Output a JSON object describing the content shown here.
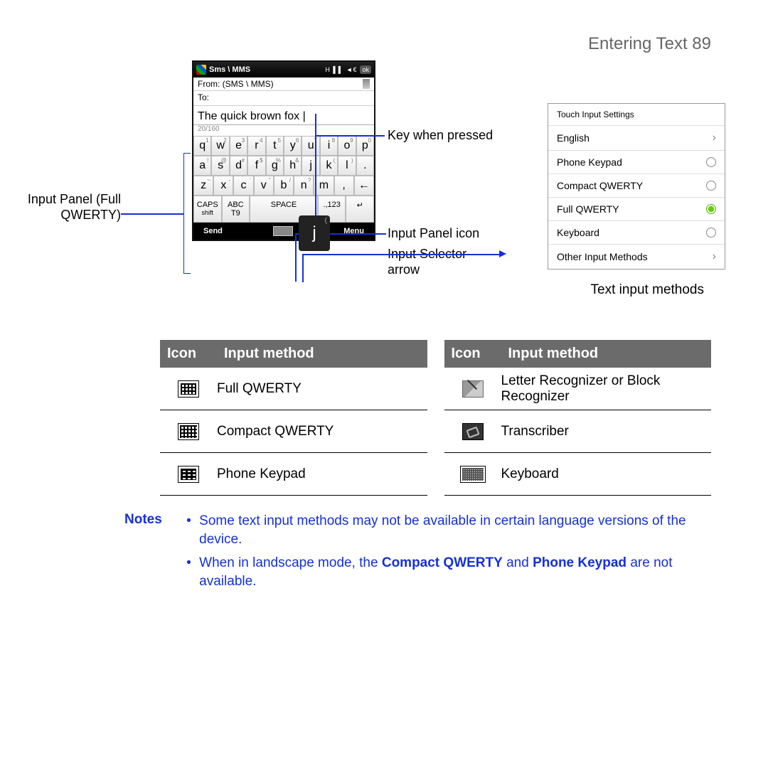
{
  "header": {
    "title": "Entering Text",
    "page": "89"
  },
  "phone": {
    "title": "Sms \\ MMS",
    "status": "H ▌▌ ◄€",
    "ok": "ok",
    "from": "From: (SMS \\ MMS)",
    "to": "To:",
    "message": "The quick brown fox",
    "counter": "20/160",
    "rows": [
      [
        {
          "k": "q",
          "s": "1"
        },
        {
          "k": "w",
          "s": "2"
        },
        {
          "k": "e",
          "s": "3"
        },
        {
          "k": "r",
          "s": "4"
        },
        {
          "k": "t",
          "s": "5"
        },
        {
          "k": "y",
          "s": "6"
        },
        {
          "k": "u",
          "s": "7"
        },
        {
          "k": "i",
          "s": "8"
        },
        {
          "k": "o",
          "s": "9"
        },
        {
          "k": "p",
          "s": "0"
        }
      ],
      [
        {
          "k": "a",
          "s": "!"
        },
        {
          "k": "s",
          "s": "@"
        },
        {
          "k": "d",
          "s": "#"
        },
        {
          "k": "f",
          "s": "$"
        },
        {
          "k": "g",
          "s": "%"
        },
        {
          "k": "h",
          "s": "&"
        },
        {
          "k": "j",
          "s": "*"
        },
        {
          "k": "k",
          "s": "("
        },
        {
          "k": "l",
          "s": ")"
        },
        {
          "k": ".",
          "s": ""
        }
      ],
      [
        {
          "k": "z",
          "s": "~"
        },
        {
          "k": "x",
          "s": "-"
        },
        {
          "k": "c",
          "s": "'"
        },
        {
          "k": "v",
          "s": "\""
        },
        {
          "k": "b",
          "s": "/"
        },
        {
          "k": "n",
          "s": "?"
        },
        {
          "k": "m",
          "s": ""
        },
        {
          "k": ",",
          "s": ""
        },
        {
          "k": "←",
          "s": ""
        }
      ],
      [
        {
          "k": "CAPS\nshift"
        },
        {
          "k": "ABC T9"
        },
        {
          "k": "SPACE"
        },
        {
          "k": ".,123"
        },
        {
          "k": "↵"
        }
      ]
    ],
    "softkeys": {
      "left": "Send",
      "right": "Menu"
    },
    "popup_key": "j"
  },
  "callouts": {
    "input_panel": "Input Panel (Full QWERTY)",
    "key_pressed": "Key when pressed",
    "panel_icon": "Input Panel icon",
    "selector_arrow": "Input Selector arrow",
    "menu_caption": "Text input methods"
  },
  "menu": {
    "title": "Touch Input Settings",
    "items": [
      {
        "label": "English",
        "type": "chev"
      },
      {
        "label": "Phone Keypad",
        "type": "radio",
        "on": false
      },
      {
        "label": "Compact QWERTY",
        "type": "radio",
        "on": false
      },
      {
        "label": "Full QWERTY",
        "type": "radio",
        "on": true
      },
      {
        "label": "Keyboard",
        "type": "radio",
        "on": false
      },
      {
        "label": "Other Input Methods",
        "type": "chev"
      }
    ]
  },
  "table_headers": {
    "icon": "Icon",
    "method": "Input method"
  },
  "left_table": [
    {
      "icon": "fullq",
      "label": "Full QWERTY"
    },
    {
      "icon": "compq",
      "label": "Compact QWERTY"
    },
    {
      "icon": "keypad",
      "label": "Phone Keypad"
    }
  ],
  "right_table": [
    {
      "icon": "recog",
      "label": "Letter Recognizer or Block Recognizer"
    },
    {
      "icon": "trans",
      "label": "Transcriber"
    },
    {
      "icon": "keyboard",
      "label": "Keyboard"
    }
  ],
  "notes": {
    "label": "Notes",
    "items": [
      {
        "pre": "Some text input methods may not be available in certain language versions of the device."
      },
      {
        "pre": "When in landscape mode, the ",
        "b1": "Compact QWERTY",
        "mid": " and ",
        "b2": "Phone Keypad",
        "post": " are not available."
      }
    ]
  }
}
